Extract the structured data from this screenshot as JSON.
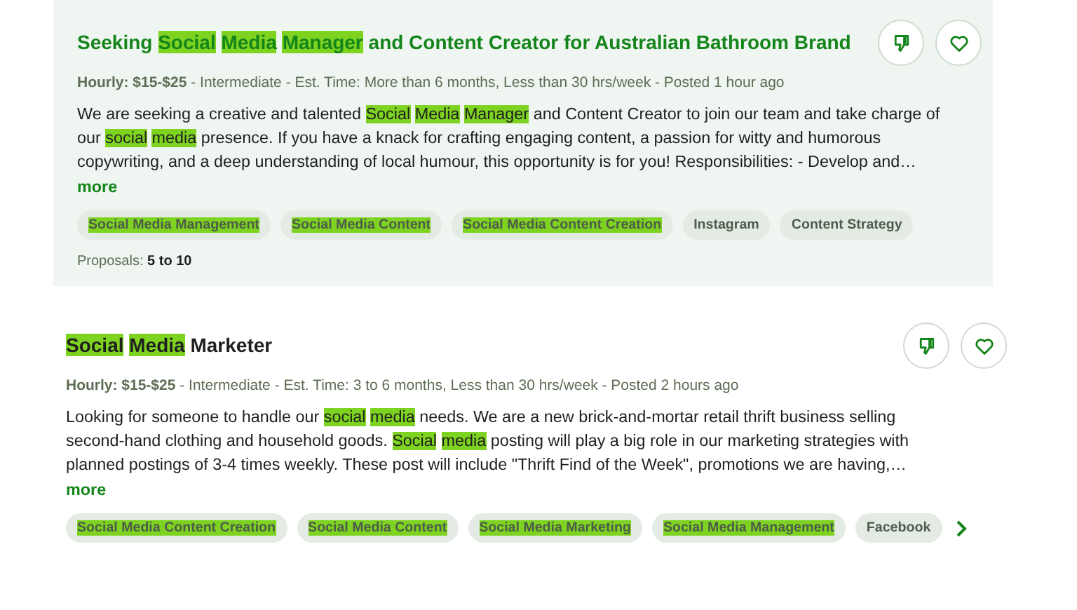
{
  "jobs": [
    {
      "hovered": true,
      "title": [
        {
          "text": "Seeking",
          "highlighted": false
        },
        {
          "text": "Social",
          "highlighted": true
        },
        {
          "text": "Media",
          "highlighted": true
        },
        {
          "text": "Manager",
          "highlighted": true
        },
        {
          "text": "and Content Creator for Australian Bathroom Brand",
          "highlighted": false
        }
      ],
      "rate": "Hourly: $15-$25",
      "meta": "- Intermediate - Est. Time: More than 6 months, Less than 30 hrs/week - Posted 1 hour ago",
      "description": [
        {
          "text": "We are seeking a creative and talented",
          "highlighted": false
        },
        {
          "text": "Social",
          "highlighted": true
        },
        {
          "text": "Media",
          "highlighted": true
        },
        {
          "text": "Manager",
          "highlighted": true
        },
        {
          "text": "and Content Creator to join our team and take charge of our",
          "highlighted": false
        },
        {
          "text": "social",
          "highlighted": true
        },
        {
          "text": "media",
          "highlighted": true
        },
        {
          "text": "presence. If you have a knack for crafting engaging content, a passion for witty and humorous copywriting, and a deep understanding of local humour, this opportunity is for you! Responsibilities: - Develop and…",
          "highlighted": false
        }
      ],
      "more": "more",
      "skills": [
        {
          "label": "Social Media Management",
          "highlighted": true
        },
        {
          "label": "Social Media Content",
          "highlighted": true
        },
        {
          "label": "Social Media Content Creation",
          "highlighted": true
        },
        {
          "label": "Instagram",
          "highlighted": false
        },
        {
          "label": "Content Strategy",
          "highlighted": false
        }
      ],
      "proposals_label": "Proposals:",
      "proposals_value": "5 to 10"
    },
    {
      "hovered": false,
      "title": [
        {
          "text": "Social",
          "highlighted": true
        },
        {
          "text": "Media",
          "highlighted": true
        },
        {
          "text": "Marketer",
          "highlighted": false
        }
      ],
      "rate": "Hourly: $15-$25",
      "meta": "- Intermediate - Est. Time: 3 to 6 months, Less than 30 hrs/week - Posted 2 hours ago",
      "description": [
        {
          "text": "Looking for someone to handle our",
          "highlighted": false
        },
        {
          "text": "social",
          "highlighted": true
        },
        {
          "text": "media",
          "highlighted": true
        },
        {
          "text": "needs. We are a new brick-and-mortar retail thrift business selling second-hand clothing and household goods.",
          "highlighted": false
        },
        {
          "text": "Social",
          "highlighted": true
        },
        {
          "text": "media",
          "highlighted": true
        },
        {
          "text": "posting will play a big role in our marketing strategies with planned postings of 3-4 times weekly. These post will include \"Thrift Find of the Week\", promotions we are having,…",
          "highlighted": false
        }
      ],
      "more": "more",
      "skills": [
        {
          "label": "Social Media Content Creation",
          "highlighted": true
        },
        {
          "label": "Social Media Content",
          "highlighted": true
        },
        {
          "label": "Social Media Marketing",
          "highlighted": true
        },
        {
          "label": "Social Media Management",
          "highlighted": true
        },
        {
          "label": "Facebook",
          "highlighted": false
        }
      ],
      "has_next": true
    }
  ]
}
